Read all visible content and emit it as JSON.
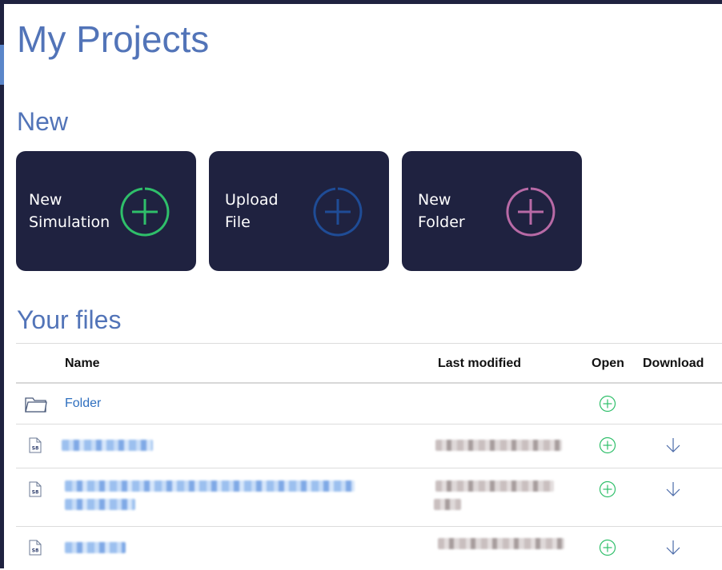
{
  "page": {
    "title": "My Projects"
  },
  "sections": {
    "new": "New",
    "files": "Your files"
  },
  "cards": [
    {
      "line1": "New",
      "line2": "Simulation",
      "accent": "#2fbf6a"
    },
    {
      "line1": "Upload",
      "line2": "File",
      "accent": "#1f4c96"
    },
    {
      "line1": "New",
      "line2": "Folder",
      "accent": "#b86aa6"
    }
  ],
  "table": {
    "headers": {
      "name": "Name",
      "last_modified": "Last modified",
      "open": "Open",
      "download": "Download"
    },
    "rows": [
      {
        "type": "folder",
        "name": "Folder"
      },
      {
        "type": "file",
        "icon_label": "S8"
      },
      {
        "type": "file",
        "icon_label": "S8"
      },
      {
        "type": "file",
        "icon_label": "S8"
      }
    ]
  },
  "colors": {
    "heading": "#5274b8",
    "card_bg": "#1f2240",
    "open_icon": "#2fbf6a",
    "download_icon": "#4a6aa8"
  },
  "icons": {
    "folder": "folder-icon",
    "file": "file-icon",
    "open": "plus-circle-icon",
    "download": "arrow-down-icon"
  }
}
